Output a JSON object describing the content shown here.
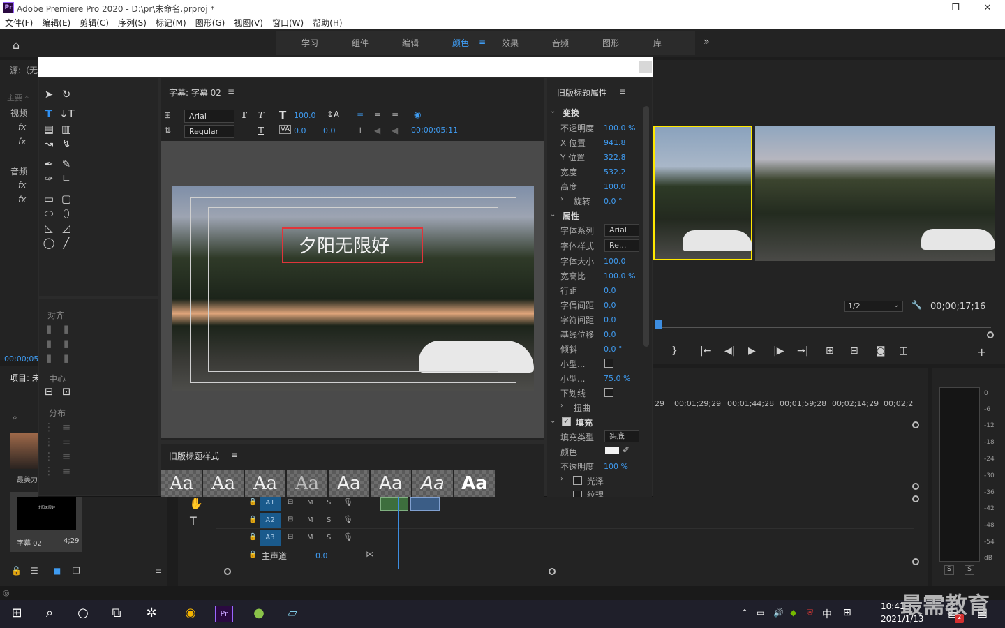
{
  "window": {
    "title": "Adobe Premiere Pro 2020 - D:\\pr\\未命名.prproj *",
    "app_icon": "Pr",
    "minimize": "—",
    "restore": "❐",
    "close": "✕"
  },
  "menu": [
    "文件(F)",
    "编辑(E)",
    "剪辑(C)",
    "序列(S)",
    "标记(M)",
    "图形(G)",
    "视图(V)",
    "窗口(W)",
    "帮助(H)"
  ],
  "workspaces": {
    "items": [
      "学习",
      "组件",
      "编辑",
      "颜色",
      "效果",
      "音频",
      "图形",
      "库"
    ],
    "active": "颜色",
    "more": "»"
  },
  "source_panel": {
    "title": "源:（无",
    "tab_main": "主要 *",
    "video": "视频",
    "audio": "音频",
    "timecode": "00;00;05;"
  },
  "project_panel": {
    "title": "项目: 未",
    "clip1_name": "最美力",
    "clip2_name": "字幕 02",
    "clip2_duration": "4;29",
    "clip2_thumb_text": "夕阳无限好"
  },
  "title_designer": {
    "header": "字幕: 字幕 02",
    "font_family": "Arial",
    "font_style": "Regular",
    "font_size": "100.0",
    "kerning": "0.0",
    "leading": "0.0",
    "timecode": "00;00;05;11",
    "canvas_text": "夕阳无限好",
    "align_label": "对齐",
    "center_label": "中心",
    "distribute_label": "分布",
    "styles_header": "旧版标题样式",
    "style_samples": [
      "Aa",
      "Aa",
      "Aa",
      "Aa",
      "Aa",
      "Aa",
      "Aa",
      "Aa"
    ]
  },
  "properties": {
    "header": "旧版标题属性",
    "transform": "变换",
    "opacity_label": "不透明度",
    "opacity": "100.0 %",
    "x_label": "X 位置",
    "x": "941.8",
    "y_label": "Y 位置",
    "y": "322.8",
    "width_label": "宽度",
    "width": "532.2",
    "height_label": "高度",
    "height": "100.0",
    "rotation_label": "旋转",
    "rotation": "0.0 °",
    "attributes": "属性",
    "font_family_label": "字体系列",
    "font_family": "Arial",
    "font_style_label": "字体样式",
    "font_style": "Re...",
    "font_size_label": "字体大小",
    "font_size": "100.0",
    "aspect_label": "宽高比",
    "aspect": "100.0 %",
    "leading_label": "行距",
    "leading": "0.0",
    "kerning_label": "字偶间距",
    "kerning": "0.0",
    "tracking_label": "字符间距",
    "tracking": "0.0",
    "baseline_label": "基线位移",
    "baseline": "0.0",
    "slant_label": "倾斜",
    "slant": "0.0 °",
    "smallcaps_label": "小型...",
    "smallcaps_size_label": "小型...",
    "smallcaps_size": "75.0 %",
    "underline_label": "下划线",
    "distort_label": "扭曲",
    "fill": "填充",
    "fill_type_label": "填充类型",
    "fill_type": "实底",
    "color_label": "颜色",
    "fill_opacity_label": "不透明度",
    "fill_opacity": "100 %",
    "sheen_label": "光泽",
    "texture_label": "纹理"
  },
  "program": {
    "zoom": "1/2",
    "timecode": "00;00;17;16"
  },
  "timeline": {
    "timecodes": [
      "29",
      "00;01;29;29",
      "00;01;44;28",
      "00;01;59;28",
      "00;02;14;29",
      "00;02;2"
    ],
    "tracks": [
      "A1",
      "A2",
      "A3"
    ],
    "master_label": "主声道",
    "master_value": "0.0",
    "m": "M",
    "s": "S"
  },
  "meter": {
    "db": [
      "0",
      "-6",
      "-12",
      "-18",
      "-24",
      "-30",
      "-36",
      "-42",
      "-48",
      "-54",
      "dB"
    ],
    "s": "S"
  },
  "taskbar": {
    "time": "10:41",
    "date": "2021/1/13",
    "ime": "中",
    "notify_count": "2",
    "watermark": "最需教育"
  }
}
